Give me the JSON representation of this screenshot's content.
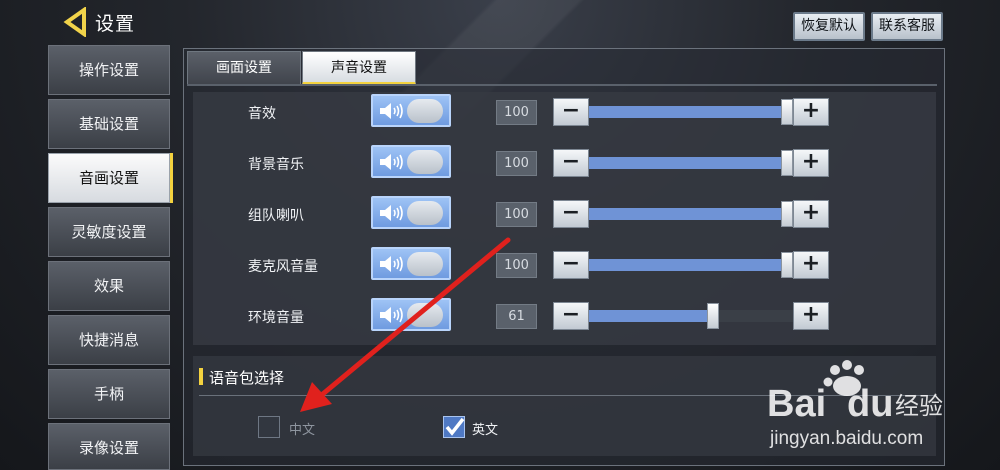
{
  "header": {
    "title": "设置",
    "restore_default": "恢复默认",
    "contact_support": "联系客服"
  },
  "sidebar": {
    "items": [
      {
        "label": "操作设置"
      },
      {
        "label": "基础设置"
      },
      {
        "label": "音画设置",
        "active": true
      },
      {
        "label": "灵敏度设置"
      },
      {
        "label": "效果"
      },
      {
        "label": "快捷消息"
      },
      {
        "label": "手柄"
      },
      {
        "label": "录像设置"
      }
    ]
  },
  "tabs": [
    {
      "label": "画面设置",
      "active": false
    },
    {
      "label": "声音设置",
      "active": true
    }
  ],
  "sound_rows": [
    {
      "label": "音效",
      "enabled": true,
      "value": "100",
      "level": 1.0
    },
    {
      "label": "背景音乐",
      "enabled": true,
      "value": "100",
      "level": 1.0
    },
    {
      "label": "组队喇叭",
      "enabled": true,
      "value": "100",
      "level": 1.0
    },
    {
      "label": "麦克风音量",
      "enabled": true,
      "value": "100",
      "level": 1.0
    },
    {
      "label": "环境音量",
      "enabled": true,
      "value": "61",
      "level": 0.61
    }
  ],
  "stepper": {
    "minus": "−",
    "plus": "+"
  },
  "voice_pack": {
    "title": "语音包选择",
    "options": [
      {
        "label": "中文",
        "checked": false
      },
      {
        "label": "英文",
        "checked": true
      }
    ]
  },
  "colors": {
    "accent": "#f3d23f",
    "slider_fill": "#6f93d6",
    "toggle_on": "#7fa8ea",
    "annotation": "#e0211d"
  },
  "watermark": {
    "logo": "Bai du 经验",
    "url": "jingyan.baidu.com"
  }
}
